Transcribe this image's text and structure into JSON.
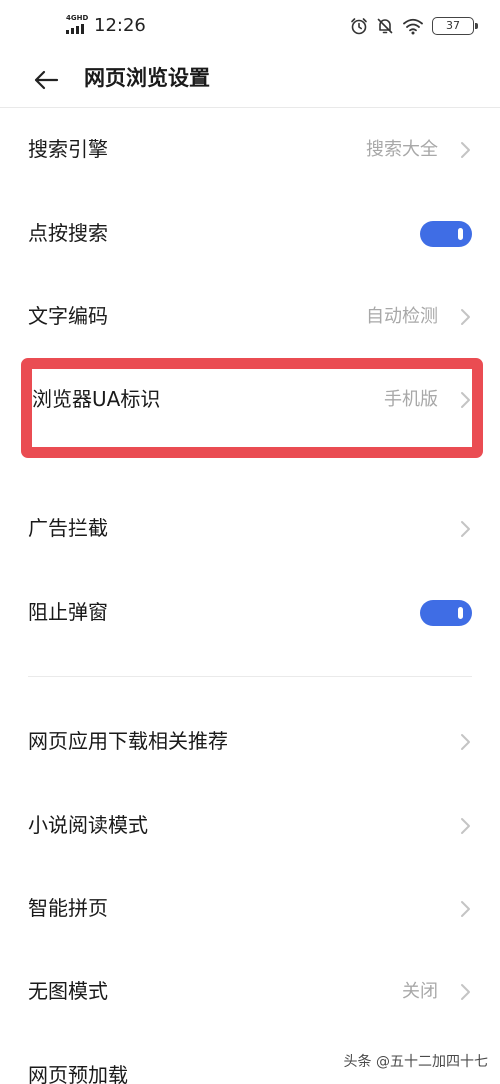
{
  "status_bar": {
    "network": "4GHD",
    "time": "12:26",
    "battery": "37"
  },
  "header": {
    "title": "网页浏览设置"
  },
  "settings": [
    {
      "label": "搜索引擎",
      "value": "搜索大全",
      "control": "chevron"
    },
    {
      "label": "点按搜索",
      "control": "toggle",
      "toggle_on": true
    },
    {
      "label": "文字编码",
      "value": "自动检测",
      "control": "chevron"
    },
    {
      "label": "浏览器UA标识",
      "value": "手机版",
      "control": "chevron",
      "highlighted": true
    },
    {
      "label": "广告拦截",
      "control": "chevron"
    },
    {
      "label": "阻止弹窗",
      "control": "toggle",
      "toggle_on": true
    },
    {
      "label": "网页应用下载相关推荐",
      "control": "chevron"
    },
    {
      "label": "小说阅读模式",
      "control": "chevron"
    },
    {
      "label": "智能拼页",
      "control": "chevron"
    },
    {
      "label": "无图模式",
      "value": "关闭",
      "control": "chevron"
    },
    {
      "label": "网页预加载",
      "control": "chevron"
    }
  ],
  "colors": {
    "toggle_on": "#3f6de5",
    "highlight_border": "#ea4c52",
    "secondary_text": "#a8a8a8"
  },
  "watermark": "头条 @五十二加四十七"
}
